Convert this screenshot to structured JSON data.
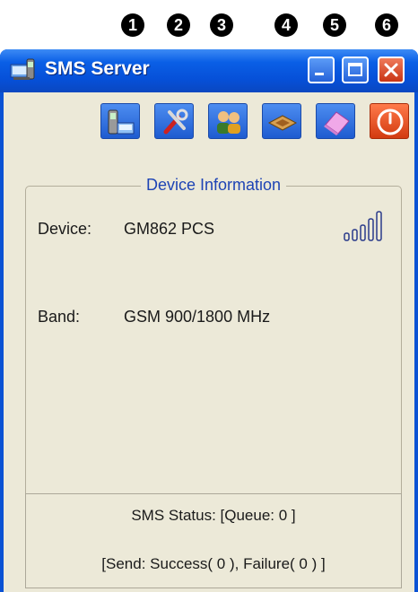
{
  "callouts": [
    "1",
    "2",
    "3",
    "4",
    "5",
    "6"
  ],
  "window": {
    "title": "SMS Server"
  },
  "toolbar": {
    "buttons": [
      {
        "name": "connect-device-button",
        "icon": "phone-connect-icon"
      },
      {
        "name": "settings-button",
        "icon": "tools-icon"
      },
      {
        "name": "users-button",
        "icon": "users-icon"
      },
      {
        "name": "message-button",
        "icon": "envelope-icon"
      },
      {
        "name": "clear-button",
        "icon": "eraser-icon"
      },
      {
        "name": "shutdown-button",
        "icon": "power-icon"
      }
    ]
  },
  "device_info": {
    "legend": "Device Information",
    "device_label": "Device:",
    "device_value": "GM862 PCS",
    "band_label": "Band:",
    "band_value": "GSM 900/1800 MHz",
    "signal_bars": 5
  },
  "status": {
    "line1": "SMS Status: [Queue: 0 ]",
    "line2": "[Send: Success( 0 ), Failure( 0 ) ]"
  },
  "colors": {
    "titlebar": "#0a5fe6",
    "legend_text": "#1e44b5",
    "close": "#d9441c",
    "face": "#ece9d8"
  }
}
